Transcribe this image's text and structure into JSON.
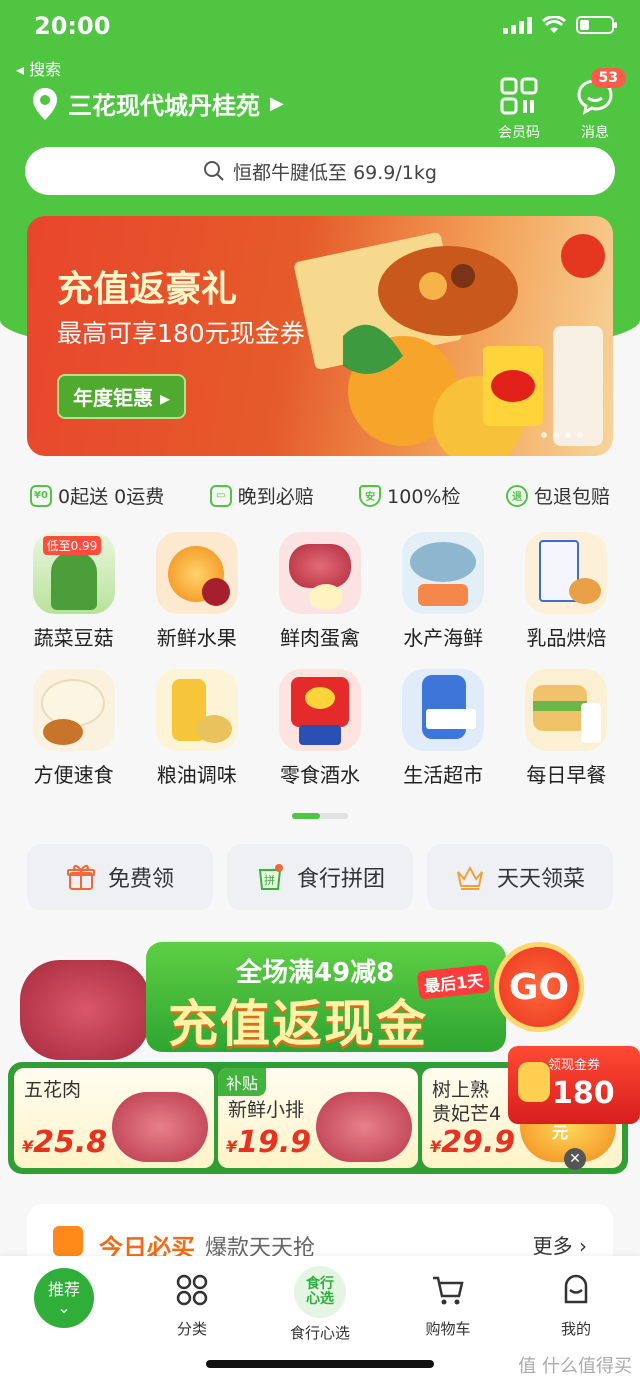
{
  "status": {
    "time": "20:00",
    "back_label": "◂ 搜索"
  },
  "header": {
    "location": "三花现代城丹桂苑",
    "member_code": "会员码",
    "messages": "消息",
    "message_count": "53"
  },
  "search": {
    "placeholder": "恒都牛腱低至 69.9/1kg"
  },
  "banner": {
    "title": "充值返豪礼",
    "subtitle": "最高可享180元现金券",
    "cta": "年度钜惠 ▸"
  },
  "services": [
    {
      "label": "0起送 0运费"
    },
    {
      "label": "晚到必赔"
    },
    {
      "label": "100%检"
    },
    {
      "label": "包退包赔"
    }
  ],
  "categories": [
    {
      "label": "蔬菜豆菇",
      "tag": "低至0.99",
      "color": "#7fc96b"
    },
    {
      "label": "新鲜水果",
      "color": "#f7a23b"
    },
    {
      "label": "鲜肉蛋禽",
      "color": "#d9485a"
    },
    {
      "label": "水产海鲜",
      "color": "#7fb5d8"
    },
    {
      "label": "乳品烘焙",
      "color": "#f5c46a"
    },
    {
      "label": "方便速食",
      "color": "#f0dcb4"
    },
    {
      "label": "粮油调味",
      "color": "#e8c04a"
    },
    {
      "label": "零食酒水",
      "color": "#e23a3a"
    },
    {
      "label": "生活超市",
      "color": "#3e7ed1"
    },
    {
      "label": "每日早餐",
      "color": "#f2c15a"
    }
  ],
  "pills": [
    {
      "label": "免费领"
    },
    {
      "label": "食行拼团"
    },
    {
      "label": "天天领菜"
    }
  ],
  "promo": {
    "headline": "全场满49减8",
    "tag": "最后1天",
    "title": "充值返现金",
    "go": "GO",
    "coupon_text": "领现金券",
    "coupon_value": "180",
    "coupon_unit": "元",
    "cards": [
      {
        "name": "五花肉",
        "price": "25.8"
      },
      {
        "badge": "补贴",
        "name": "新鲜小排",
        "price": "19.9"
      },
      {
        "name": "树上熟\n贵妃芒4",
        "price": "29.9"
      }
    ],
    "currency": "¥"
  },
  "daily": {
    "title": "今日必买",
    "desc": "爆款天天抢",
    "more": "更多 ›"
  },
  "tabs": {
    "home": "推荐",
    "category": "分类",
    "center": "食行心选",
    "center_logo": "食行\n心选",
    "cart": "购物车",
    "mine": "我的"
  },
  "watermark": "值 什么值得买",
  "colors": {
    "brand_green": "#4fc542",
    "accent_red": "#e8311e",
    "accent_orange": "#f36b16"
  }
}
